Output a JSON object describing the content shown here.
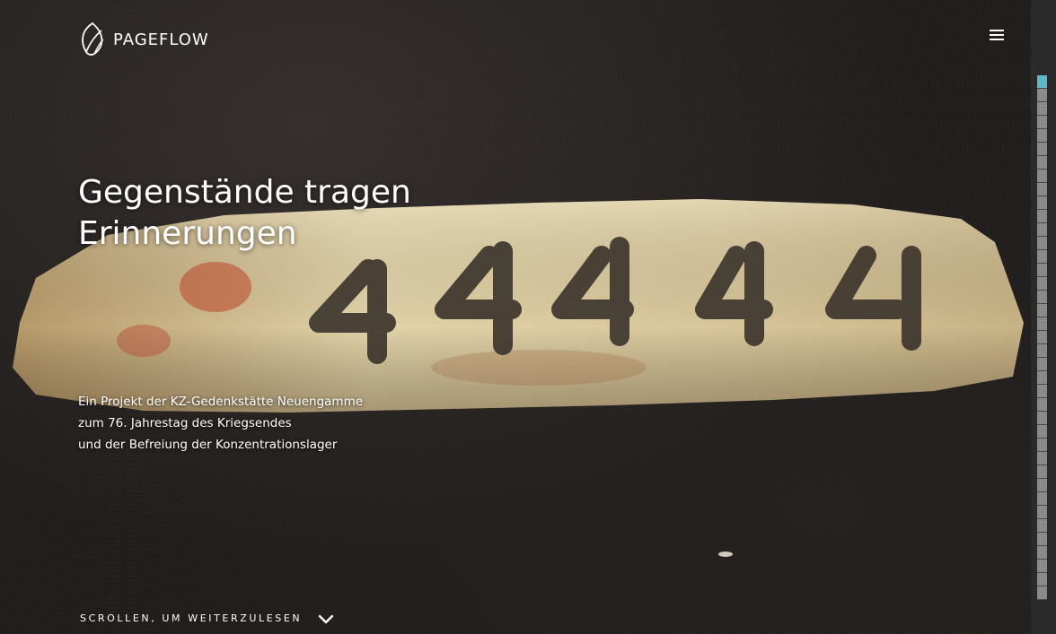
{
  "brand": {
    "name": "PAGEFLOW",
    "logo_icon": "pageflow-leaf-icon"
  },
  "header": {
    "menu_icon": "hamburger-menu-icon"
  },
  "hero": {
    "title_line1": "Gegenstände tragen",
    "title_line2": "Erinnerungen",
    "subtitle_line1": "Ein Projekt der KZ-Gedenkstätte Neuengamme",
    "subtitle_line2": "zum 76. Jahrestag des Kriegsendes",
    "subtitle_line3": "und der Befreiung der Konzentrationslager",
    "background_image_text": "44444"
  },
  "scroll_hint": {
    "label": "SCROLLEN, UM WEITERZULESEN",
    "icon": "chevron-down-icon"
  },
  "navigation": {
    "page_count": 39,
    "active_index": 0,
    "active_color": "#5fb7c9",
    "inactive_color": "#8a8a8a"
  },
  "colors": {
    "text": "#ffffff",
    "background": "#1a1817",
    "cloth": "#d8c79a"
  }
}
